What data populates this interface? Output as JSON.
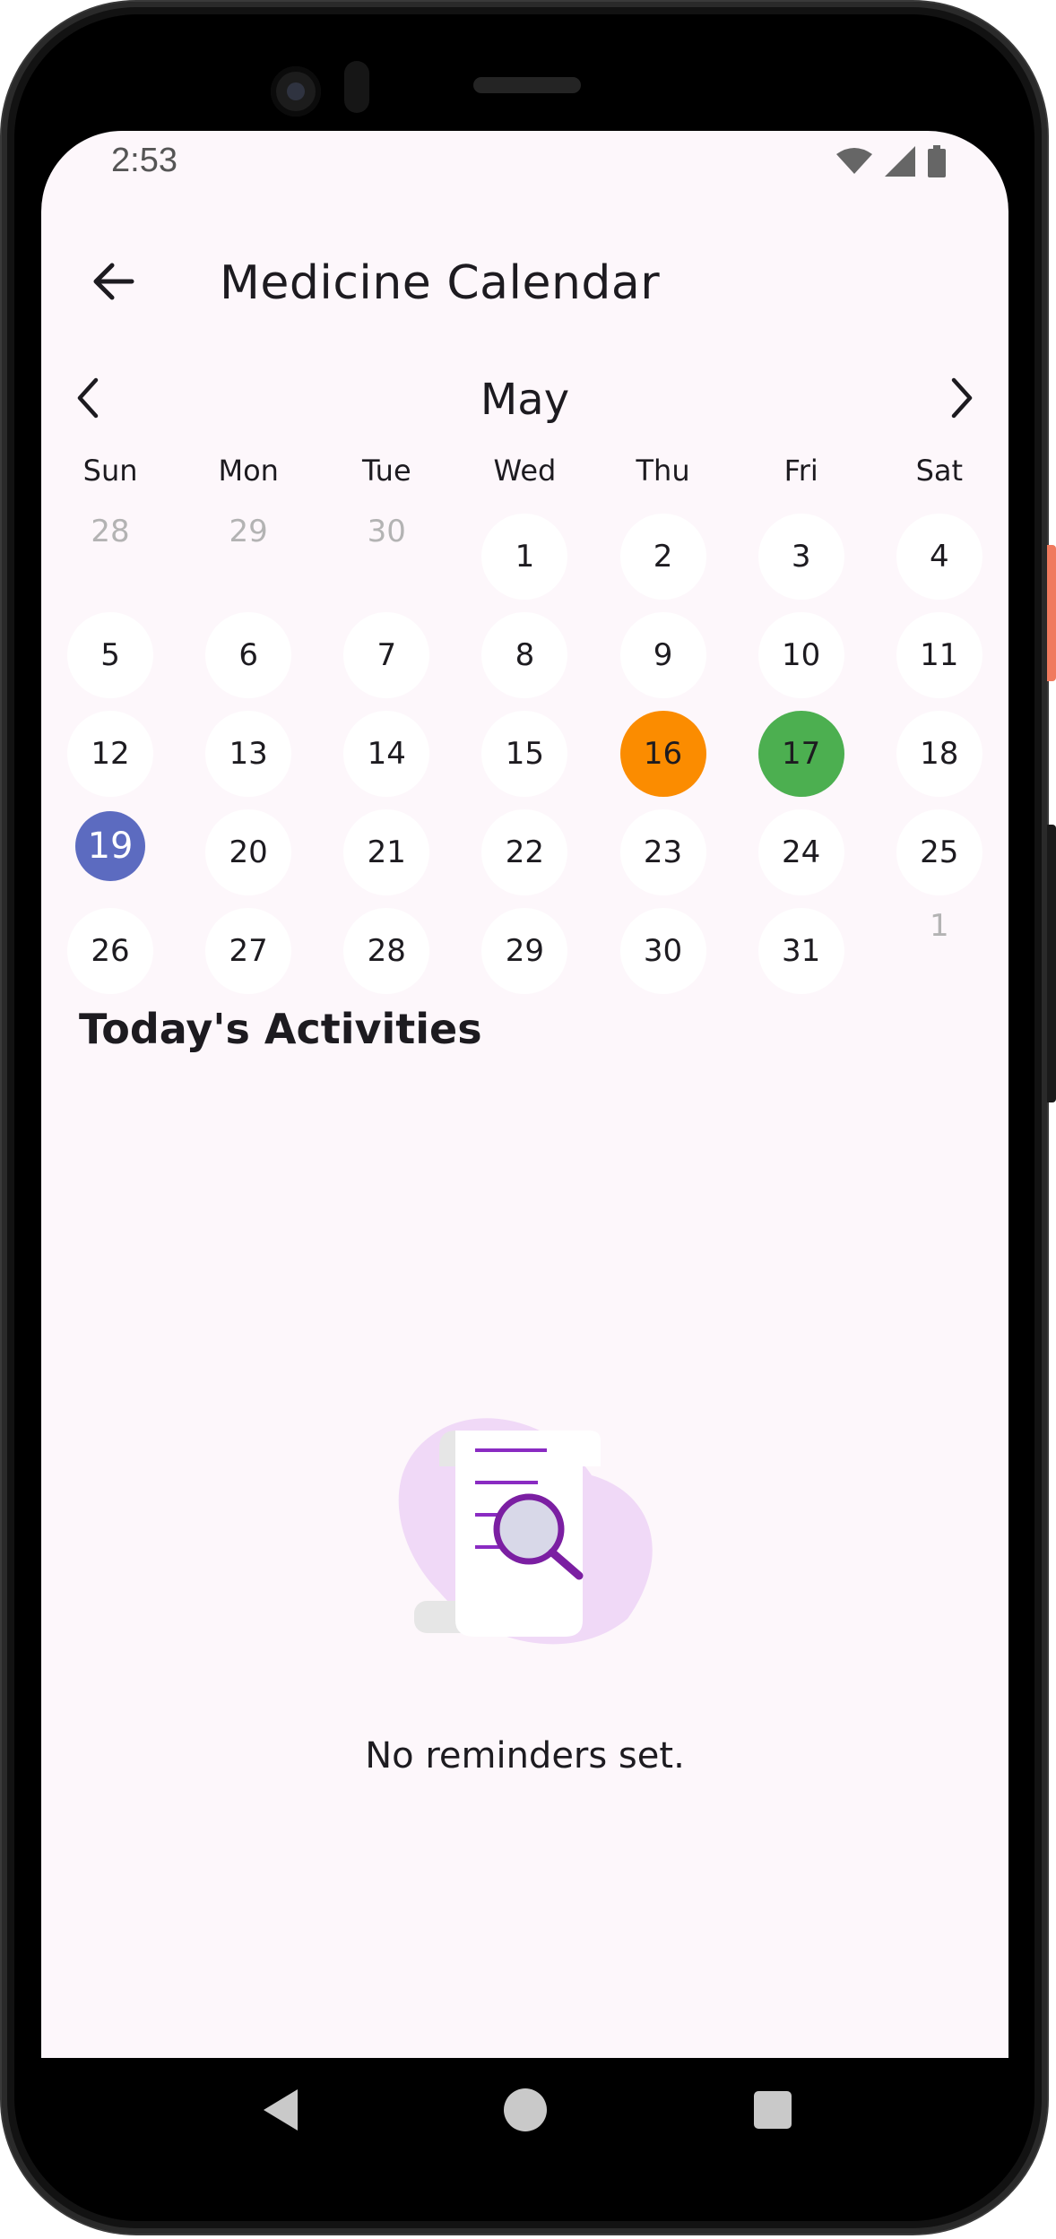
{
  "status_bar": {
    "time": "2:53",
    "icons": [
      "wifi-icon",
      "signal-icon",
      "battery-icon"
    ]
  },
  "app_bar": {
    "title": "Medicine Calendar",
    "back_icon": "arrow-left-icon"
  },
  "calendar": {
    "month": "May",
    "prev_icon": "chevron-left-icon",
    "next_icon": "chevron-right-icon",
    "weekdays": [
      "Sun",
      "Mon",
      "Tue",
      "Wed",
      "Thu",
      "Fri",
      "Sat"
    ],
    "days": [
      {
        "label": "28",
        "outside": true
      },
      {
        "label": "29",
        "outside": true
      },
      {
        "label": "30",
        "outside": true
      },
      {
        "label": "1"
      },
      {
        "label": "2"
      },
      {
        "label": "3"
      },
      {
        "label": "4"
      },
      {
        "label": "5"
      },
      {
        "label": "6"
      },
      {
        "label": "7"
      },
      {
        "label": "8"
      },
      {
        "label": "9"
      },
      {
        "label": "10"
      },
      {
        "label": "11"
      },
      {
        "label": "12"
      },
      {
        "label": "13"
      },
      {
        "label": "14"
      },
      {
        "label": "15"
      },
      {
        "label": "16",
        "highlight": "orange"
      },
      {
        "label": "17",
        "highlight": "green"
      },
      {
        "label": "18"
      },
      {
        "label": "19",
        "highlight": "today"
      },
      {
        "label": "20"
      },
      {
        "label": "21"
      },
      {
        "label": "22"
      },
      {
        "label": "23"
      },
      {
        "label": "24"
      },
      {
        "label": "25"
      },
      {
        "label": "26"
      },
      {
        "label": "27"
      },
      {
        "label": "28"
      },
      {
        "label": "29"
      },
      {
        "label": "30"
      },
      {
        "label": "31"
      },
      {
        "label": "1",
        "outside": true
      }
    ],
    "colors": {
      "orange": "#fb8c00",
      "green": "#4caf50",
      "today": "#5c6bc0"
    }
  },
  "activities": {
    "section_title": "Today's Activities",
    "empty_message": "No reminders set.",
    "empty_icon": "document-search-illustration"
  },
  "nav_bar": {
    "icons": [
      "nav-back-icon",
      "nav-home-icon",
      "nav-recents-icon"
    ]
  }
}
